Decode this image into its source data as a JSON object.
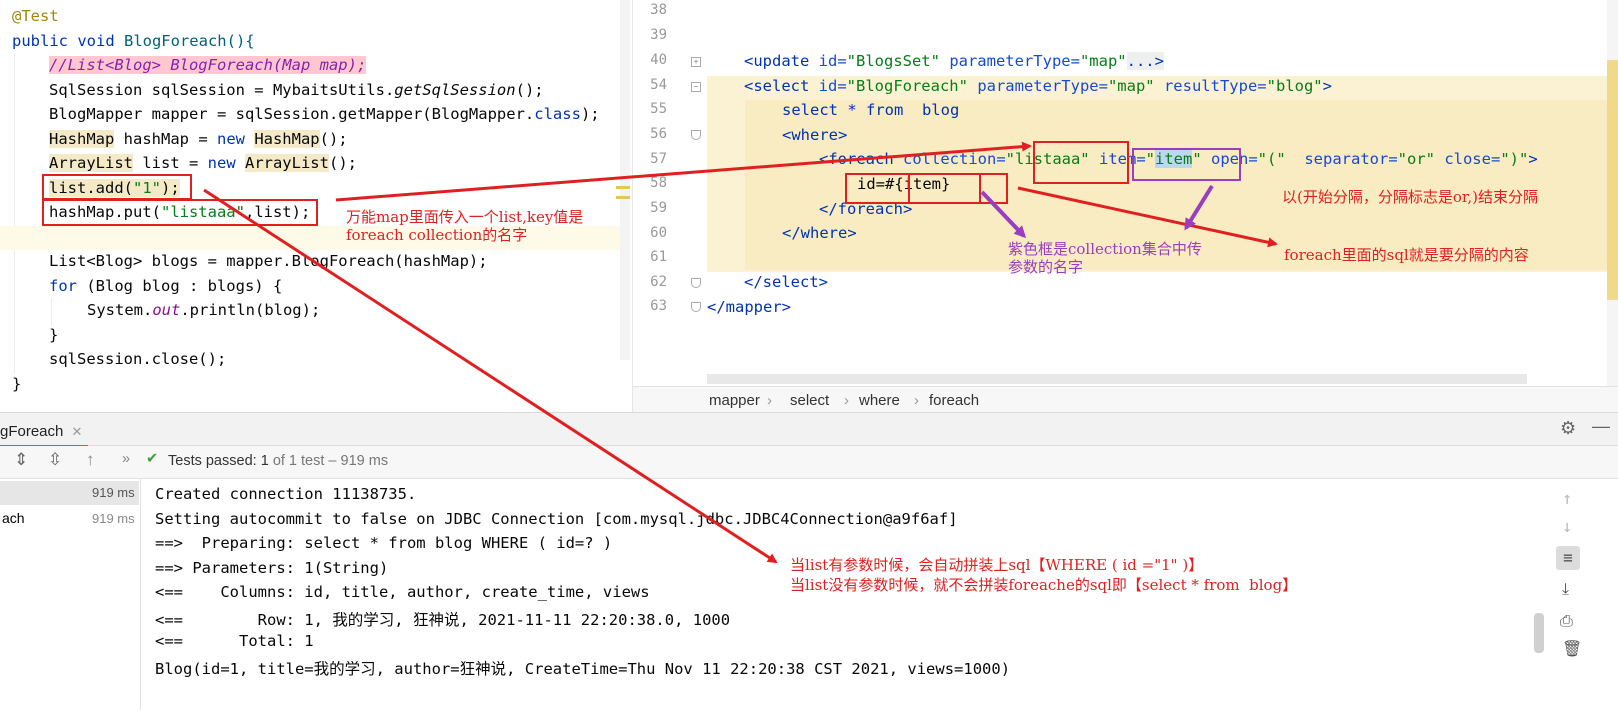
{
  "java_editor": {
    "lines": [
      {
        "id": "l1",
        "text": "@Test"
      },
      {
        "id": "l2a",
        "text": "public void "
      },
      {
        "id": "l2b",
        "text": "BlogForeach(){"
      },
      {
        "id": "l3",
        "text": "//List<Blog> BlogForeach(Map map);"
      },
      {
        "id": "l4a",
        "text": "SqlSession sqlSession = MybaitsUtils."
      },
      {
        "id": "l4b",
        "text": "getSqlSession"
      },
      {
        "id": "l4c",
        "text": "();"
      },
      {
        "id": "l5a",
        "text": "BlogMapper mapper = sqlSession.getMapper(BlogMapper."
      },
      {
        "id": "l5b",
        "text": "class"
      },
      {
        "id": "l5c",
        "text": ");"
      },
      {
        "id": "l6a",
        "text": "HashMap"
      },
      {
        "id": "l6b",
        "text": " hashMap = "
      },
      {
        "id": "l6c",
        "text": "new "
      },
      {
        "id": "l6d",
        "text": "HashMap"
      },
      {
        "id": "l6e",
        "text": "();"
      },
      {
        "id": "l7a",
        "text": "ArrayList"
      },
      {
        "id": "l7b",
        "text": " list = "
      },
      {
        "id": "l7c",
        "text": "new "
      },
      {
        "id": "l7d",
        "text": "ArrayList"
      },
      {
        "id": "l7e",
        "text": "();"
      },
      {
        "id": "l8a",
        "text": "list.add("
      },
      {
        "id": "l8b",
        "text": "\"1\""
      },
      {
        "id": "l8c",
        "text": ");"
      },
      {
        "id": "l9a",
        "text": "hashMap.put("
      },
      {
        "id": "l9b",
        "text": "\"listaaa\""
      },
      {
        "id": "l9c",
        "text": ",list);"
      },
      {
        "id": "l11",
        "text": "List<Blog> blogs = mapper.BlogForeach(hashMap);"
      },
      {
        "id": "l12a",
        "text": "for "
      },
      {
        "id": "l12b",
        "text": "(Blog blog : blogs) {"
      },
      {
        "id": "l13a",
        "text": "System."
      },
      {
        "id": "l13b",
        "text": "out"
      },
      {
        "id": "l13c",
        "text": ".println(blog);"
      },
      {
        "id": "l14",
        "text": "}"
      },
      {
        "id": "l15",
        "text": "sqlSession.close();"
      },
      {
        "id": "l16",
        "text": "}"
      }
    ]
  },
  "xml_editor": {
    "line_numbers": [
      "38",
      "39",
      "40",
      "54",
      "55",
      "56",
      "57",
      "58",
      "59",
      "60",
      "61",
      "62",
      "63"
    ],
    "x40a": "<update ",
    "x40b": "id=",
    "x40c": "\"BlogsSet\"",
    "x40d": " parameterType=",
    "x40e": "\"map\"",
    "x40f": "...>",
    "x54a": "<select ",
    "x54b": "id=",
    "x54c": "\"BlogForeach\"",
    "x54d": " parameterType=",
    "x54e": "\"map\"",
    "x54f": " resultType=",
    "x54g": "\"blog\"",
    "x54h": ">",
    "x55": "select * from  blog",
    "x56": "<where>",
    "x57a": "<foreach ",
    "x57b": "collection=",
    "x57c": "\"listaaa\"",
    "x57d": " item=",
    "x57e": "\"",
    "x57f": "item",
    "x57g": "\"",
    "x57h": " open=",
    "x57i": "\"(\"",
    "x57j": "  separator=",
    "x57k": "\"or\"",
    "x57l": " close=",
    "x57m": "\")\"",
    "x57n": ">",
    "x58": "id=#{item}",
    "x59": "</foreach>",
    "x60": "</where>",
    "x62": "</select>",
    "x63": "</mapper>"
  },
  "breadcrumb": [
    "mapper",
    "select",
    "where",
    "foreach"
  ],
  "run_panel": {
    "tab_label": "gForeach",
    "status_prefix": "Tests passed:",
    "status_count": "1",
    "status_suffix": "of 1 test – 919 ms",
    "tree_items": [
      {
        "name": "",
        "time": "919 ms"
      },
      {
        "name": "ach",
        "time": "919 ms"
      }
    ],
    "console_lines": [
      "Created connection 11138735.",
      "Setting autocommit to false on JDBC Connection [com.mysql.jdbc.JDBC4Connection@a9f6af]",
      "==>  Preparing: select * from blog WHERE ( id=? )",
      "==> Parameters: 1(String)",
      "<==    Columns: id, title, author, create_time, views",
      "<==        Row: 1, 我的学习, 狂神说, 2021-11-11 22:20:38.0, 1000",
      "<==      Total: 1",
      "Blog(id=1, title=我的学习, author=狂神说, CreateTime=Thu Nov 11 22:20:38 CST 2021, views=1000)"
    ]
  },
  "annotations": {
    "note_map": "万能map里面传入一个list,key值是\nforeach collection的名字",
    "note_purple": "紫色框是collection集合中传\n参数的名字",
    "note_separator": "以(开始分隔，分隔标志是or,)结束分隔",
    "note_sql": "foreach里面的sql就是要分隔的内容",
    "note_console1": "当list有参数时候，会自动拼装上sql【WHERE ( id =\"1\" )】",
    "note_console2": "当list没有参数时候，就不会拼装foreache的sql即【select * from  blog】"
  },
  "colors": {
    "annotation_red": "#e02020",
    "annotation_purple": "#9b3dc0",
    "xml_highlight": "#fbf2d4",
    "pass_green": "#3d9b3d"
  }
}
